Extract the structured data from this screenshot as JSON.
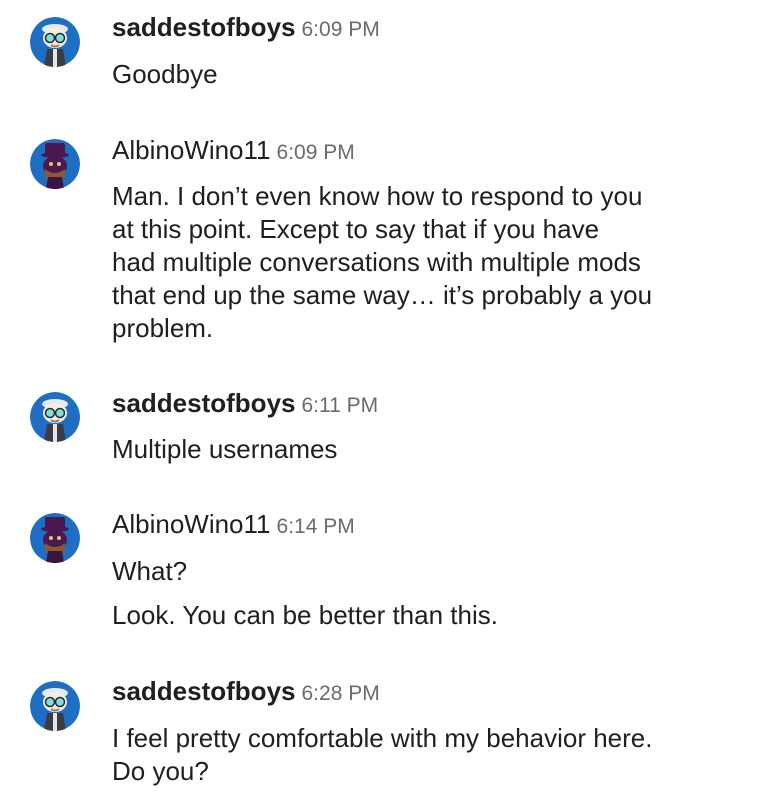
{
  "messages": [
    {
      "user": "saddestofboys",
      "time": "6:09 PM",
      "avatar_icon": "glasses-character-avatar-icon",
      "lines": [
        "Goodbye"
      ]
    },
    {
      "user": "AlbinoWino11",
      "time": "6:09 PM",
      "avatar_icon": "top-hat-character-avatar-icon",
      "lines": [
        "Man.  I don’t even know how to respond to you",
        "at this point.  Except to say that if you have",
        "had multiple conversations with multiple mods",
        "that end up the same way… it’s probably a you",
        "problem."
      ]
    },
    {
      "user": "saddestofboys",
      "time": "6:11 PM",
      "avatar_icon": "glasses-character-avatar-icon",
      "lines": [
        "Multiple usernames"
      ]
    },
    {
      "user": "AlbinoWino11",
      "time": "6:14 PM",
      "avatar_icon": "top-hat-character-avatar-icon",
      "lines": [
        "What?"
      ],
      "followup": "Look.  You can be better than this."
    },
    {
      "user": "saddestofboys",
      "time": "6:28 PM",
      "avatar_icon": "glasses-character-avatar-icon",
      "lines": [
        "I feel pretty comfortable with my behavior here.",
        "Do you?"
      ]
    }
  ],
  "colors": {
    "avatar_bg": "#1e6fc4",
    "top_hat_body": "#4b1850",
    "top_hat_face": "#8a5a2b",
    "text": "#1f1f1f",
    "timestamp": "#6b6b6b"
  }
}
